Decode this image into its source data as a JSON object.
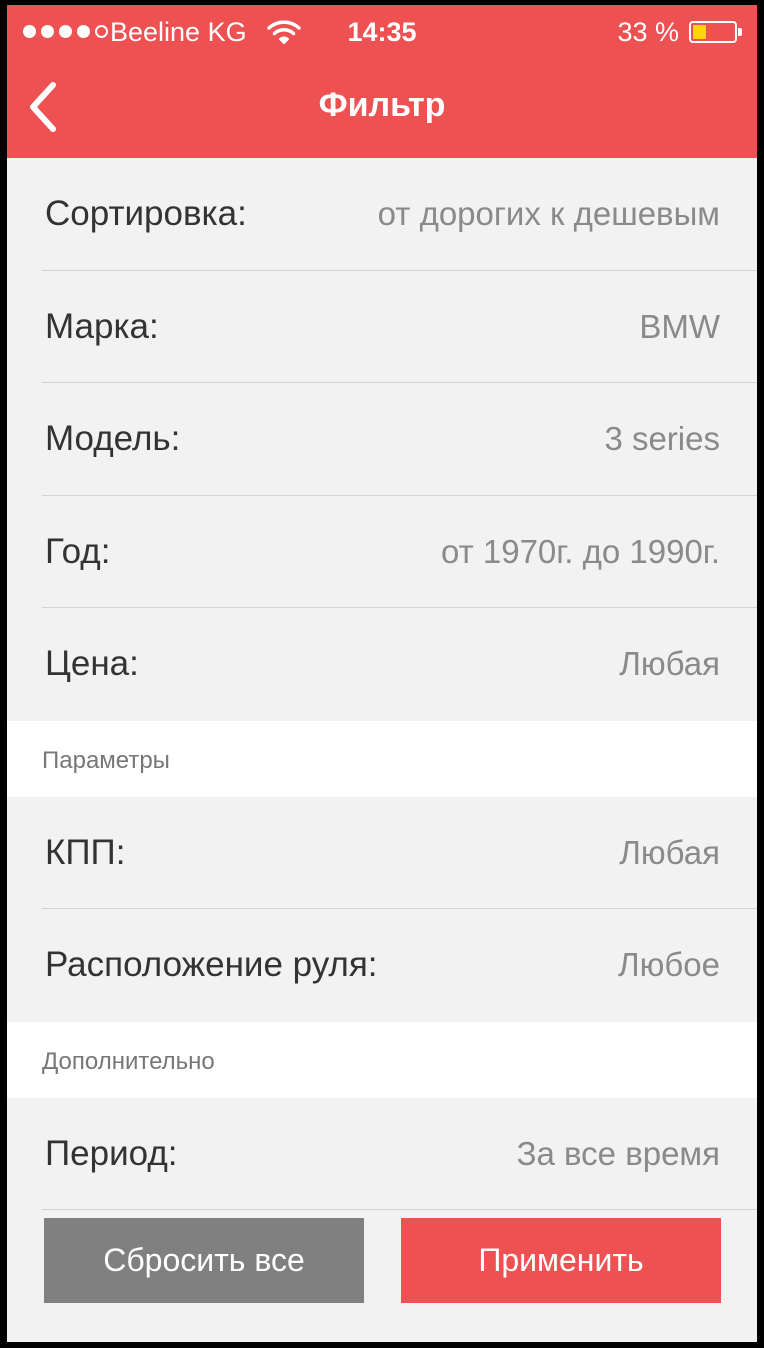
{
  "status_bar": {
    "carrier": "Beeline KG",
    "time": "14:35",
    "battery_percent": "33 %",
    "battery_level": 0.33,
    "signal_bars": 4,
    "signal_max": 5,
    "battery_color": "#ffd60a"
  },
  "header": {
    "title": "Фильтр",
    "back_icon": "chevron-left-icon",
    "color": "#ee5152"
  },
  "filters": {
    "sort": {
      "label": "Сортировка:",
      "value": "от дорогих к дешевым"
    },
    "brand": {
      "label": "Марка:",
      "value": "BMW"
    },
    "model": {
      "label": "Модель:",
      "value": "3 series"
    },
    "year": {
      "label": "Год:",
      "value": "от 1970г. до 1990г."
    },
    "price": {
      "label": "Цена:",
      "value": "Любая"
    }
  },
  "parameters": {
    "header": "Параметры",
    "transmission": {
      "label": "КПП:",
      "value": "Любая"
    },
    "steering": {
      "label": "Расположение руля:",
      "value": "Любое"
    }
  },
  "additional": {
    "header": "Дополнительно",
    "period": {
      "label": "Период:",
      "value": "За все время"
    }
  },
  "buttons": {
    "reset": "Сбросить все",
    "apply": "Применить"
  }
}
